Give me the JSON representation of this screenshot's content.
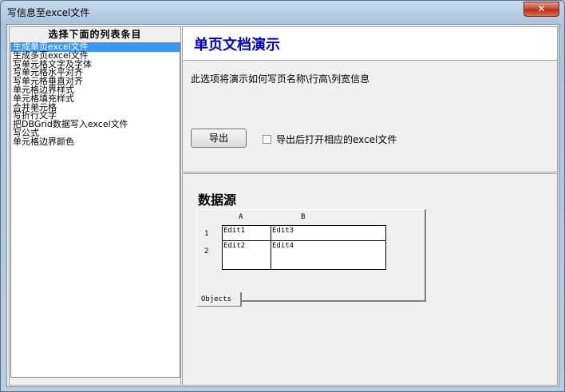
{
  "window": {
    "title": "写信息至excel文件",
    "close_glyph": "✕"
  },
  "sidebar": {
    "header": "选择下面的列表条目",
    "items": [
      {
        "label": "生成单页excel文件",
        "selected": true
      },
      {
        "label": "生成多页excel文件"
      },
      {
        "label": "写单元格文字及字体"
      },
      {
        "label": "写单元格水平对齐"
      },
      {
        "label": "写单元格垂直对齐"
      },
      {
        "label": "单元格边界样式"
      },
      {
        "label": "单元格填充样式"
      },
      {
        "label": "合并单元格"
      },
      {
        "label": "写折行文字"
      },
      {
        "label": "把DBGrid数据写入excel文件"
      },
      {
        "label": "写公式"
      },
      {
        "label": "单元格边界颜色"
      }
    ]
  },
  "main": {
    "title": "单页文档演示",
    "description": "此选项将演示如何写页名称\\行高\\列宽信息",
    "export_button": "导出",
    "open_after_export_label": "导出后打开相应的excel文件",
    "open_after_export_checked": false
  },
  "datasource": {
    "title": "数据源",
    "columns": [
      "A",
      "B"
    ],
    "rows": [
      {
        "num": "1",
        "cells": [
          "Edit1",
          "Edit3"
        ]
      },
      {
        "num": "2",
        "cells": [
          "Edit2",
          "Edit4"
        ]
      }
    ],
    "tab_label": "Objects"
  },
  "colors": {
    "selection": "#3399ff",
    "title_blue": "#0000c0"
  }
}
